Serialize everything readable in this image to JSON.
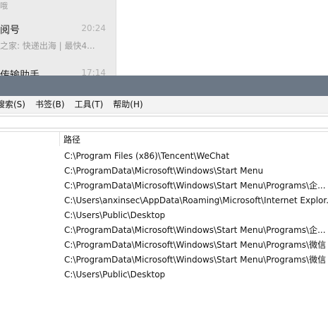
{
  "chat": {
    "top_cut_text": "哦",
    "item1": {
      "name": "阅号",
      "time": "20:24",
      "preview": "之家: 快递出海 | 最快4..."
    },
    "item2": {
      "name": "传输助手",
      "time": "17:14"
    }
  },
  "window": {
    "menu": [
      "搜索(S)",
      "书签(B)",
      "工具(T)",
      "帮助(H)"
    ],
    "search": {
      "value": ""
    },
    "table": {
      "header": "路径",
      "paths": [
        "C:\\Program Files (x86)\\Tencent\\WeChat",
        "C:\\ProgramData\\Microsoft\\Windows\\Start Menu",
        "C:\\ProgramData\\Microsoft\\Windows\\Start Menu\\Programs\\企...",
        "C:\\Users\\anxinsec\\AppData\\Roaming\\Microsoft\\Internet Explor...",
        "C:\\Users\\Public\\Desktop",
        "C:\\ProgramData\\Microsoft\\Windows\\Start Menu\\Programs\\企...",
        "C:\\ProgramData\\Microsoft\\Windows\\Start Menu\\Programs\\微信",
        "C:\\ProgramData\\Microsoft\\Windows\\Start Menu\\Programs\\微信",
        "C:\\Users\\Public\\Desktop"
      ]
    }
  },
  "colors": {
    "titlebar": "#6c7886",
    "chat_list_bg": "#ebebeb"
  }
}
